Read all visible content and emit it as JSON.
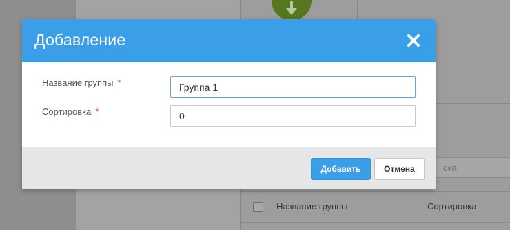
{
  "background": {
    "search_placeholder": "ска",
    "table_headers": [
      "Название группы",
      "Сортировка"
    ]
  },
  "modal": {
    "title": "Добавление",
    "close_icon": "close-icon",
    "fields": [
      {
        "label": "Название группы",
        "required_mark": "*",
        "value": "Группа 1"
      },
      {
        "label": "Сортировка",
        "required_mark": "*",
        "value": "0"
      }
    ],
    "buttons": {
      "submit": "Добавить",
      "cancel": "Отмена"
    }
  },
  "colors": {
    "accent": "#3b9ee8",
    "required": "#e0443c",
    "footer_bg": "#e6e6e6"
  }
}
